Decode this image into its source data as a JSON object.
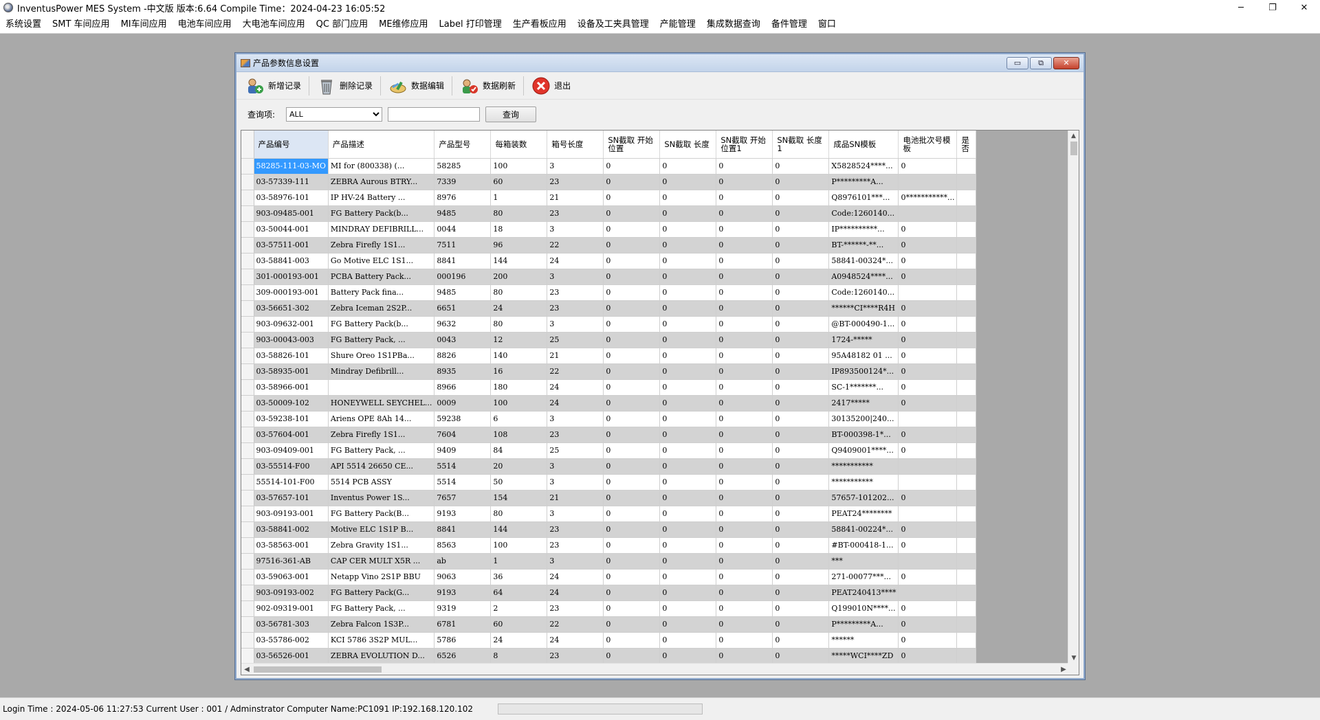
{
  "app": {
    "title": "InventusPower MES System -中文版 版本:6.64 Compile Time：2024-04-23 16:05:52",
    "minimize": "─",
    "restore": "❐",
    "close": "✕"
  },
  "menu": [
    "系统设置",
    "SMT 车间应用",
    "MI车间应用",
    "电池车间应用",
    "大电池车间应用",
    "QC 部门应用",
    "ME维修应用",
    "Label 打印管理",
    "生产看板应用",
    "设备及工夹具管理",
    "产能管理",
    "集成数据查询",
    "备件管理",
    "窗口"
  ],
  "child": {
    "title": "产品参数信息设置",
    "min": "▭",
    "restore": "⧉",
    "close": "✕"
  },
  "toolbar": {
    "add": "新增记录",
    "delete": "删除记录",
    "edit": "数据编辑",
    "refresh": "数据刷新",
    "exit": "退出"
  },
  "query": {
    "label": "查询项:",
    "select_value": "ALL",
    "input_value": "",
    "button": "查询"
  },
  "grid": {
    "columns": [
      "产品编号",
      "产品描述",
      "产品型号",
      "每箱装数",
      "箱号长度",
      "SN截取 开始位置",
      "SN截取 长度",
      "SN截取 开始位置1",
      "SN截取 长度1",
      "成品SN模板",
      "电池批次号模板",
      "是否"
    ],
    "rows": [
      [
        "58285-111-03-MO",
        "MI for (800338) (...",
        "58285",
        "100",
        "3",
        "0",
        "0",
        "0",
        "0",
        "X5828524****...",
        "0"
      ],
      [
        "03-57339-111",
        "ZEBRA Aurous BTRY...",
        "7339",
        "60",
        "23",
        "0",
        "0",
        "0",
        "0",
        "P*********A...",
        ""
      ],
      [
        "03-58976-101",
        "IP HV-24 Battery ...",
        "8976",
        "1",
        "21",
        "0",
        "0",
        "0",
        "0",
        "Q8976101***...",
        "0***********..."
      ],
      [
        "903-09485-001",
        "FG Battery Pack(b...",
        "9485",
        "80",
        "23",
        "0",
        "0",
        "0",
        "0",
        "Code:1260140...",
        ""
      ],
      [
        "03-50044-001",
        "MINDRAY DEFIBRILL...",
        "0044",
        "18",
        "3",
        "0",
        "0",
        "0",
        "0",
        "IP**********...",
        "0"
      ],
      [
        "03-57511-001",
        "Zebra Firefly 1S1...",
        "7511",
        "96",
        "22",
        "0",
        "0",
        "0",
        "0",
        "BT-******-**...",
        "0"
      ],
      [
        "03-58841-003",
        "Go Motive ELC 1S1...",
        "8841",
        "144",
        "24",
        "0",
        "0",
        "0",
        "0",
        "58841-00324*...",
        "0"
      ],
      [
        "301-000193-001",
        "PCBA Battery Pack...",
        "000196",
        "200",
        "3",
        "0",
        "0",
        "0",
        "0",
        "A0948524****...",
        "0"
      ],
      [
        "309-000193-001",
        "Battery Pack fina...",
        "9485",
        "80",
        "23",
        "0",
        "0",
        "0",
        "0",
        "Code:1260140...",
        ""
      ],
      [
        "03-56651-302",
        "Zebra Iceman 2S2P...",
        "6651",
        "24",
        "23",
        "0",
        "0",
        "0",
        "0",
        "******CI****R4H",
        "0"
      ],
      [
        "903-09632-001",
        "FG Battery Pack(b...",
        "9632",
        "80",
        "3",
        "0",
        "0",
        "0",
        "0",
        "@BT-000490-1...",
        "0"
      ],
      [
        "903-00043-003",
        "FG Battery Pack, ...",
        "0043",
        "12",
        "25",
        "0",
        "0",
        "0",
        "0",
        "1724-*****",
        "0"
      ],
      [
        "03-58826-101",
        "Shure Oreo 1S1PBa...",
        "8826",
        "140",
        "21",
        "0",
        "0",
        "0",
        "0",
        "95A48182 01 ...",
        "0"
      ],
      [
        "03-58935-001",
        "Mindray Defibrill...",
        "8935",
        "16",
        "22",
        "0",
        "0",
        "0",
        "0",
        "IP893500124*...",
        "0"
      ],
      [
        "03-58966-001",
        "",
        "8966",
        "180",
        "24",
        "0",
        "0",
        "0",
        "0",
        "SC-1*******...",
        "0"
      ],
      [
        "03-50009-102",
        "HONEYWELL SEYCHEL...",
        "0009",
        "100",
        "24",
        "0",
        "0",
        "0",
        "0",
        "2417*****",
        "0"
      ],
      [
        "03-59238-101",
        "Ariens OPE 8Ah 14...",
        "59238",
        "6",
        "3",
        "0",
        "0",
        "0",
        "0",
        "30135200|240...",
        ""
      ],
      [
        "03-57604-001",
        "Zebra Firefly 1S1...",
        "7604",
        "108",
        "23",
        "0",
        "0",
        "0",
        "0",
        "BT-000398-1*...",
        "0"
      ],
      [
        "903-09409-001",
        "FG Battery Pack, ...",
        "9409",
        "84",
        "25",
        "0",
        "0",
        "0",
        "0",
        "Q9409001****...",
        "0"
      ],
      [
        "03-55514-F00",
        "API 5514 26650 CE...",
        "5514",
        "20",
        "3",
        "0",
        "0",
        "0",
        "0",
        "***********",
        ""
      ],
      [
        "55514-101-F00",
        "5514 PCB ASSY",
        "5514",
        "50",
        "3",
        "0",
        "0",
        "0",
        "0",
        "***********",
        ""
      ],
      [
        "03-57657-101",
        "Inventus Power 1S...",
        "7657",
        "154",
        "21",
        "0",
        "0",
        "0",
        "0",
        "57657-101202...",
        "0"
      ],
      [
        "903-09193-001",
        "FG Battery Pack(B...",
        "9193",
        "80",
        "3",
        "0",
        "0",
        "0",
        "0",
        "PEAT24********",
        ""
      ],
      [
        "03-58841-002",
        "Motive ELC 1S1P B...",
        "8841",
        "144",
        "23",
        "0",
        "0",
        "0",
        "0",
        "58841-00224*...",
        "0"
      ],
      [
        "03-58563-001",
        "Zebra Gravity 1S1...",
        "8563",
        "100",
        "23",
        "0",
        "0",
        "0",
        "0",
        "#BT-000418-1...",
        "0"
      ],
      [
        "97516-361-AB",
        "CAP CER MULT X5R ...",
        "ab",
        "1",
        "3",
        "0",
        "0",
        "0",
        "0",
        "***",
        ""
      ],
      [
        "03-59063-001",
        "Netapp Vino 2S1P BBU",
        "9063",
        "36",
        "24",
        "0",
        "0",
        "0",
        "0",
        "271-00077***...",
        "0"
      ],
      [
        "903-09193-002",
        "FG Battery Pack(G...",
        "9193",
        "64",
        "24",
        "0",
        "0",
        "0",
        "0",
        "PEAT240413****",
        ""
      ],
      [
        "902-09319-001",
        "FG Battery Pack, ...",
        "9319",
        "2",
        "23",
        "0",
        "0",
        "0",
        "0",
        "Q199010N****...",
        "0"
      ],
      [
        "03-56781-303",
        "Zebra Falcon 1S3P...",
        "6781",
        "60",
        "22",
        "0",
        "0",
        "0",
        "0",
        "P*********A...",
        "0"
      ],
      [
        "03-55786-002",
        "KCI 5786 3S2P MUL...",
        "5786",
        "24",
        "24",
        "0",
        "0",
        "0",
        "0",
        "******",
        "0"
      ],
      [
        "03-56526-001",
        "ZEBRA EVOLUTION D...",
        "6526",
        "8",
        "23",
        "0",
        "0",
        "0",
        "0",
        "*****WCI****ZD",
        "0"
      ]
    ]
  },
  "status": {
    "text": "Login Time : 2024-05-06 11:27:53  Current User : 001 / Adminstrator  Computer Name:PC1091  IP:192.168.120.102"
  },
  "icons": {
    "add": "add-record-icon",
    "delete": "recycle-bin-icon",
    "edit": "edit-data-icon",
    "refresh": "refresh-data-icon",
    "exit": "exit-icon"
  }
}
